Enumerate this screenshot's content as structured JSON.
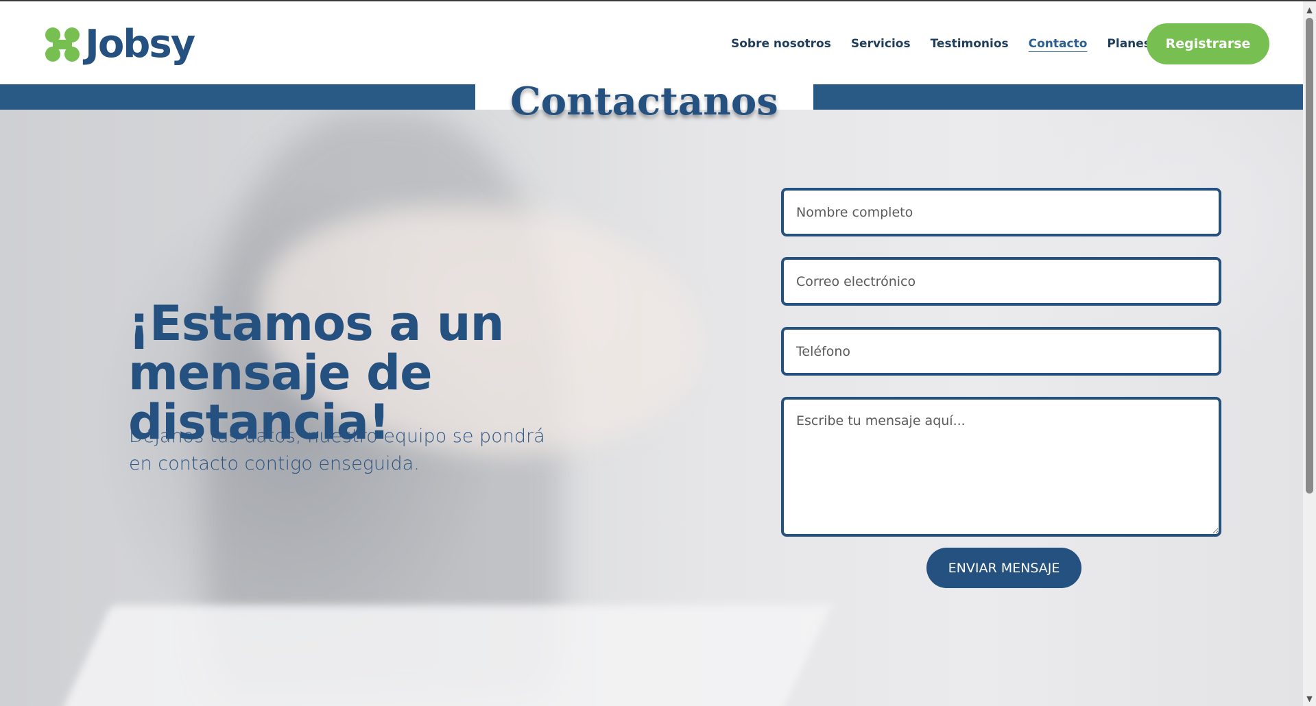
{
  "brand": {
    "name": "Jobsy",
    "primary_color": "#24517f",
    "accent_color": "#77bf51"
  },
  "nav": {
    "items": [
      {
        "label": "Sobre nosotros",
        "active": false
      },
      {
        "label": "Servicios",
        "active": false
      },
      {
        "label": "Testimonios",
        "active": false
      },
      {
        "label": "Contacto",
        "active": true
      },
      {
        "label": "Planes",
        "active": false
      }
    ],
    "register_label": "Registrarse"
  },
  "section": {
    "title": "Contactanos"
  },
  "hero": {
    "heading": "¡Estamos a un mensaje de distancia!",
    "subheading": "Déjanos tus datos, nuestro equipo se pondrá en contacto contigo enseguida."
  },
  "form": {
    "name_placeholder": "Nombre completo",
    "email_placeholder": "Correo electrónico",
    "phone_placeholder": "Teléfono",
    "message_placeholder": "Escribe tu mensaje aquí...",
    "submit_label": "ENVIAR MENSAJE"
  }
}
